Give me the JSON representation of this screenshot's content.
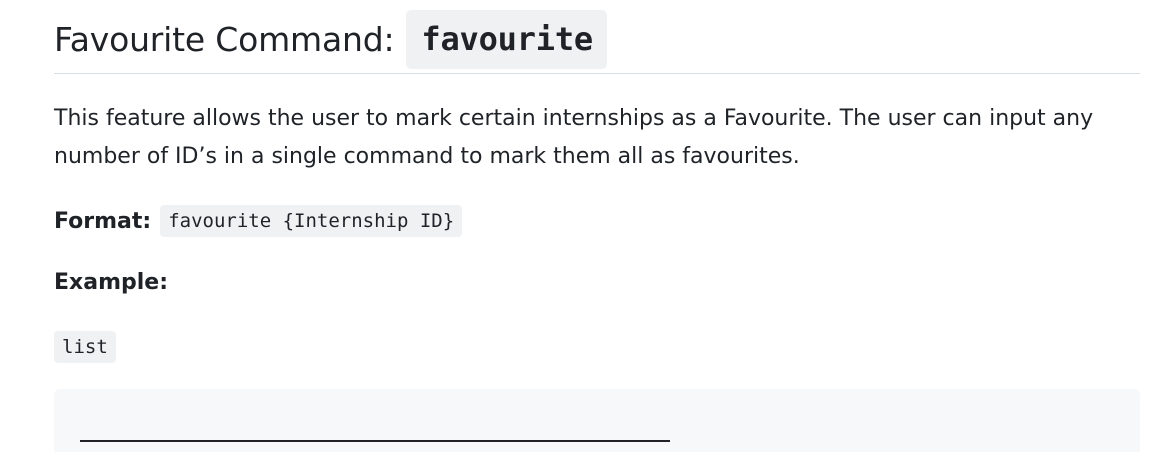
{
  "section": {
    "title_text": "Favourite Command:",
    "title_code": "favourite",
    "description": "This feature allows the user to mark certain internships as a Favourite. The user can input any number of ID’s in a single command to mark them all as favourites.",
    "format_label": "Format:",
    "format_code": "favourite {Internship ID}",
    "example_label": "Example:",
    "example_code": "list"
  }
}
